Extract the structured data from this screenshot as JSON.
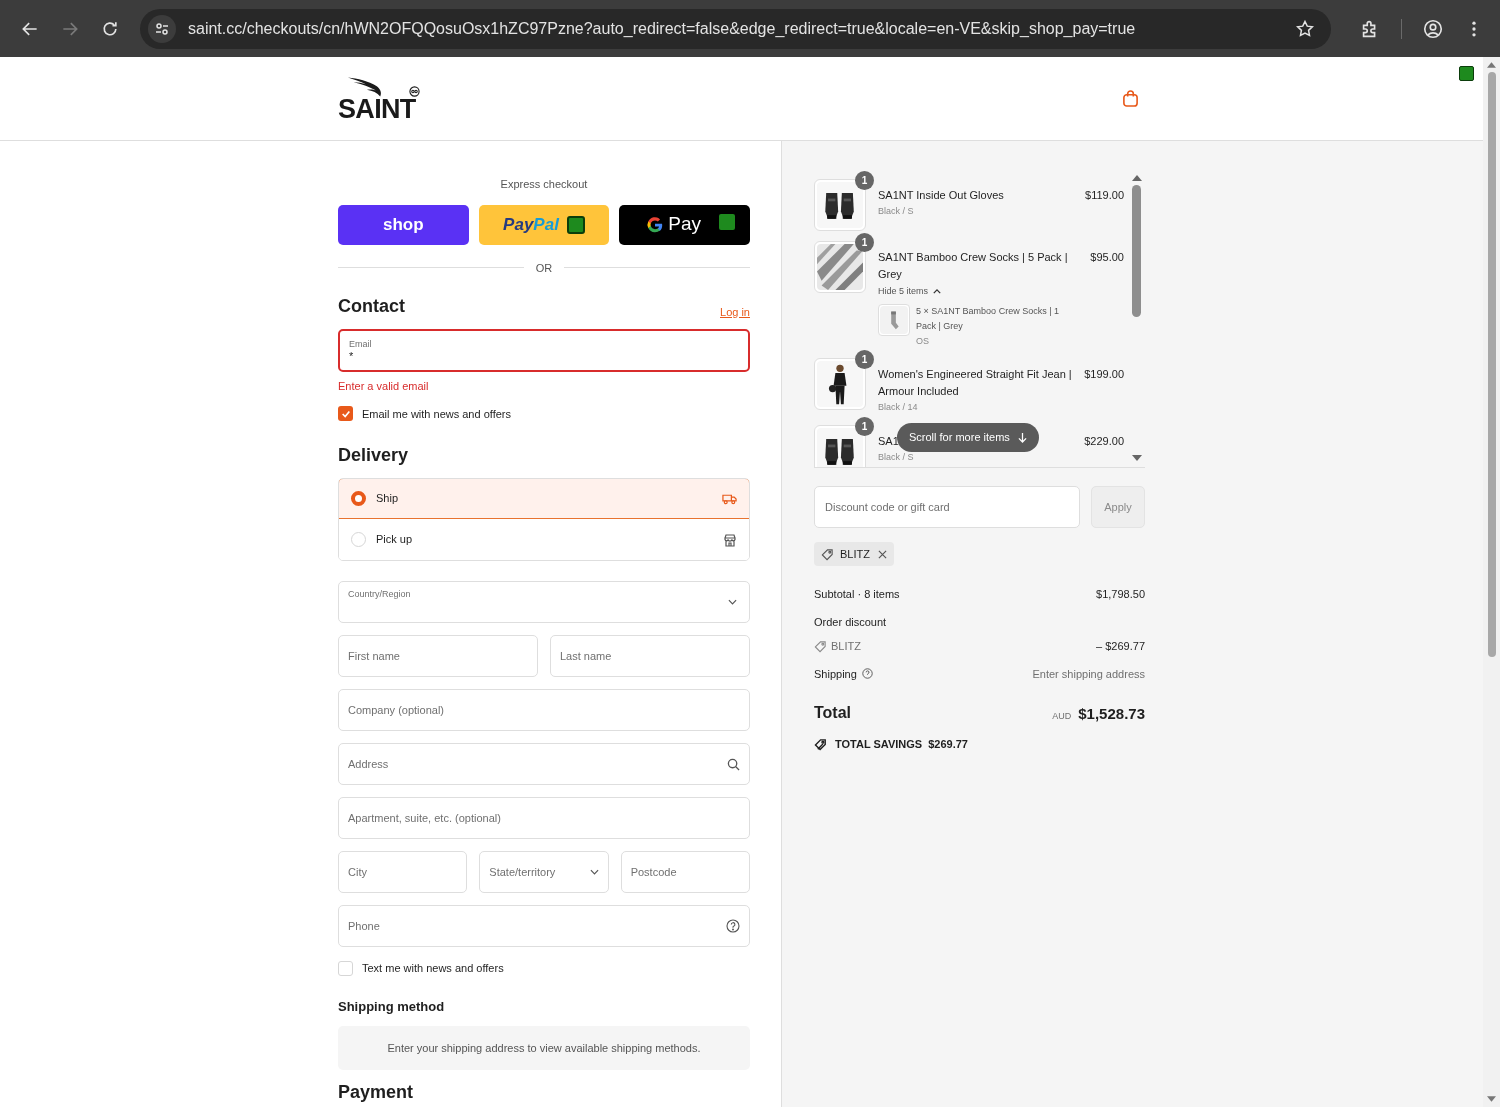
{
  "browser": {
    "url": "saint.cc/checkouts/cn/hWN2OFQQosuOsx1hZC97Pzne?auto_redirect=false&edge_redirect=true&locale=en-VE&skip_shop_pay=true",
    "forward_disabled": true
  },
  "header": {
    "logo": "SAINT"
  },
  "express": {
    "title": "Express checkout",
    "buttons": [
      {
        "kind": "shop",
        "label": "shop"
      },
      {
        "kind": "paypal",
        "label_parts": [
          "Pay",
          "Pal"
        ]
      },
      {
        "kind": "gpay",
        "label": "Pay"
      }
    ],
    "divider": "OR"
  },
  "contact": {
    "title": "Contact",
    "login": "Log in",
    "email": {
      "label": "Email",
      "value": "*",
      "invalid": true,
      "error": "Enter a valid email"
    },
    "newsletter": {
      "label": "Email me with news and offers",
      "checked": true
    }
  },
  "delivery": {
    "title": "Delivery",
    "options": [
      {
        "kind": "ship",
        "label": "Ship",
        "selected": true
      },
      {
        "kind": "pickup",
        "label": "Pick up",
        "selected": false
      }
    ]
  },
  "address_rows": [
    {
      "fields": [
        {
          "kind": "select",
          "label": "Country/Region"
        }
      ]
    },
    {
      "fields": [
        {
          "kind": "text",
          "placeholder": "First name"
        },
        {
          "kind": "text",
          "placeholder": "Last name"
        }
      ]
    },
    {
      "fields": [
        {
          "kind": "text",
          "placeholder": "Company (optional)"
        }
      ]
    },
    {
      "fields": [
        {
          "kind": "address",
          "placeholder": "Address"
        }
      ]
    },
    {
      "fields": [
        {
          "kind": "text",
          "placeholder": "Apartment, suite, etc. (optional)"
        }
      ]
    },
    {
      "fields": [
        {
          "kind": "text",
          "placeholder": "City"
        },
        {
          "kind": "select",
          "placeholder": "State/territory"
        },
        {
          "kind": "text",
          "placeholder": "Postcode"
        }
      ]
    },
    {
      "fields": [
        {
          "kind": "phone",
          "placeholder": "Phone"
        }
      ]
    }
  ],
  "sms": {
    "label": "Text me with news and offers",
    "checked": false
  },
  "shipping_method": {
    "title": "Shipping method",
    "message": "Enter your shipping address to view available shipping methods."
  },
  "payment": {
    "title": "Payment"
  },
  "summary": {
    "items": [
      {
        "quantity": "1",
        "title": "SA1NT Inside Out Gloves",
        "variant": "Black / S",
        "price": "$119.00"
      },
      {
        "quantity": "1",
        "title": "SA1NT Bamboo Crew Socks | 5 Pack | Grey",
        "price": "$95.00",
        "bundle": {
          "toggle": "Hide 5 items",
          "expanded": true,
          "items": [
            {
              "title": "5 × SA1NT Bamboo Crew Socks | 1 Pack | Grey",
              "variant": "OS"
            }
          ]
        }
      },
      {
        "quantity": "1",
        "title": "Women's Engineered Straight Fit Jean | Armour Included",
        "variant": "Black / 14",
        "price": "$199.00"
      },
      {
        "quantity": "1",
        "title": "SA1",
        "variant": "Black / S",
        "price": "$229.00"
      }
    ],
    "scroll_hint": "Scroll for more items",
    "discount": {
      "placeholder": "Discount code or gift card",
      "apply": "Apply"
    },
    "codes": [
      {
        "label": "BLITZ"
      }
    ],
    "subtotal": {
      "label": "Subtotal · 8 items",
      "value": "$1,798.50"
    },
    "order_discount": {
      "label": "Order discount",
      "code": "BLITZ",
      "value": "– $269.77"
    },
    "shipping": {
      "label": "Shipping",
      "value": "Enter shipping address"
    },
    "total": {
      "label": "Total",
      "currency": "AUD",
      "value": "$1,528.73"
    },
    "savings": {
      "label": "TOTAL SAVINGS",
      "value": "$269.77"
    }
  }
}
